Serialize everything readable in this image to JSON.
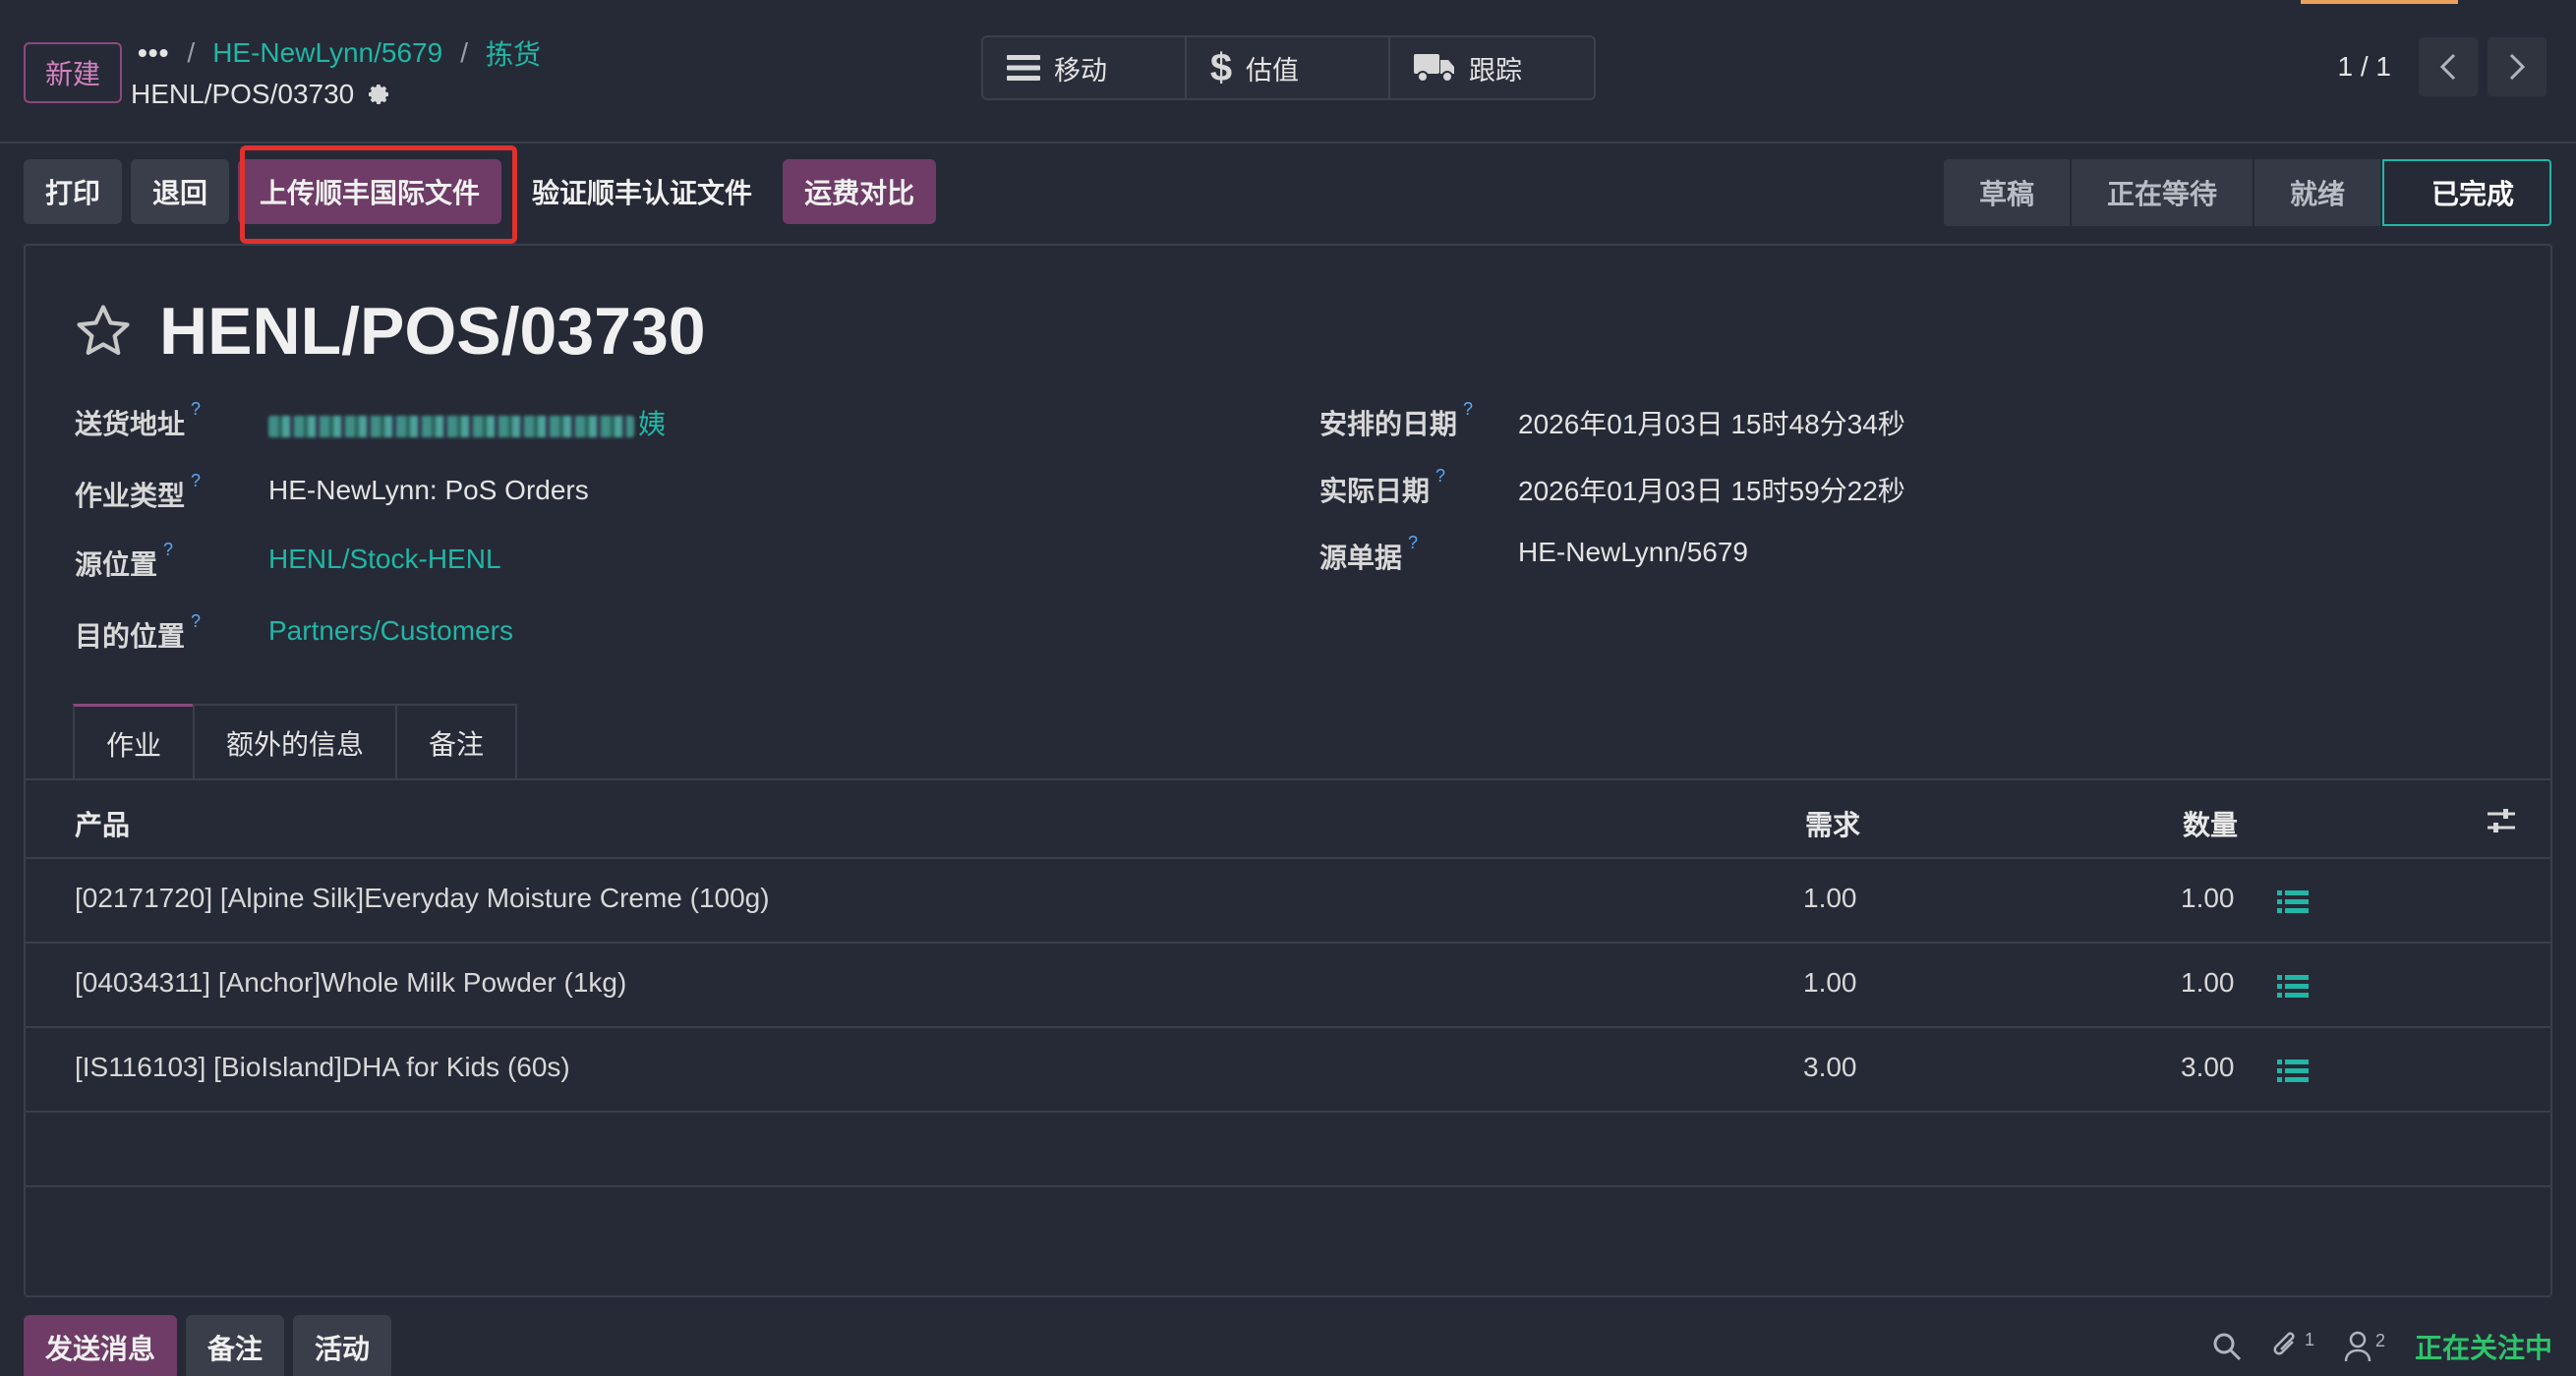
{
  "header": {
    "new_button": "新建",
    "breadcrumb": {
      "ellipsis": "•••",
      "parent": "HE-NewLynn/5679",
      "current": "拣货"
    },
    "record_name": "HENL/POS/03730",
    "smart_buttons": [
      {
        "label": "移动",
        "icon": "list-icon"
      },
      {
        "label": "估值",
        "icon": "dollar-icon"
      },
      {
        "label": "跟踪",
        "icon": "truck-icon"
      }
    ],
    "pager": {
      "count": "1 / 1"
    }
  },
  "actions": {
    "print": "打印",
    "return": "退回",
    "upload_sf": "上传顺丰国际文件",
    "verify_sf": "验证顺丰认证文件",
    "freight_compare": "运费对比"
  },
  "status": {
    "stages": [
      "草稿",
      "正在等待",
      "就绪",
      "已完成"
    ],
    "active": "已完成"
  },
  "form": {
    "title": "HENL/POS/03730",
    "left_fields": [
      {
        "label": "送货地址",
        "value": "姨",
        "is_link": true
      },
      {
        "label": "作业类型",
        "value": "HE-NewLynn: PoS Orders",
        "is_link": false
      },
      {
        "label": "源位置",
        "value": "HENL/Stock-HENL",
        "is_link": true
      },
      {
        "label": "目的位置",
        "value": "Partners/Customers",
        "is_link": true
      }
    ],
    "right_fields": [
      {
        "label": "安排的日期",
        "value": "2026年01月03日 15时48分34秒"
      },
      {
        "label": "实际日期",
        "value": "2026年01月03日 15时59分22秒"
      },
      {
        "label": "源单据",
        "value": "HE-NewLynn/5679"
      }
    ],
    "help_mark": "?"
  },
  "tabs": [
    "作业",
    "额外的信息",
    "备注"
  ],
  "table": {
    "headers": {
      "product": "产品",
      "demand": "需求",
      "quantity": "数量"
    },
    "rows": [
      {
        "product": "[02171720] [Alpine Silk]Everyday Moisture Creme (100g)",
        "demand": "1.00",
        "quantity": "1.00"
      },
      {
        "product": "[04034311] [Anchor]Whole Milk Powder (1kg)",
        "demand": "1.00",
        "quantity": "1.00"
      },
      {
        "product": "[IS116103] [BioIsland]DHA for Kids (60s)",
        "demand": "3.00",
        "quantity": "3.00"
      }
    ]
  },
  "chatter": {
    "send_message": "发送消息",
    "log_note": "备注",
    "activity": "活动",
    "attachments_count": "1",
    "followers_count": "2",
    "following": "正在关注中"
  },
  "colors": {
    "background": "#262a36",
    "primary": "#6e3c66",
    "link": "#21b6a6",
    "highlight": "#e0312f",
    "following": "#2ec46b"
  }
}
